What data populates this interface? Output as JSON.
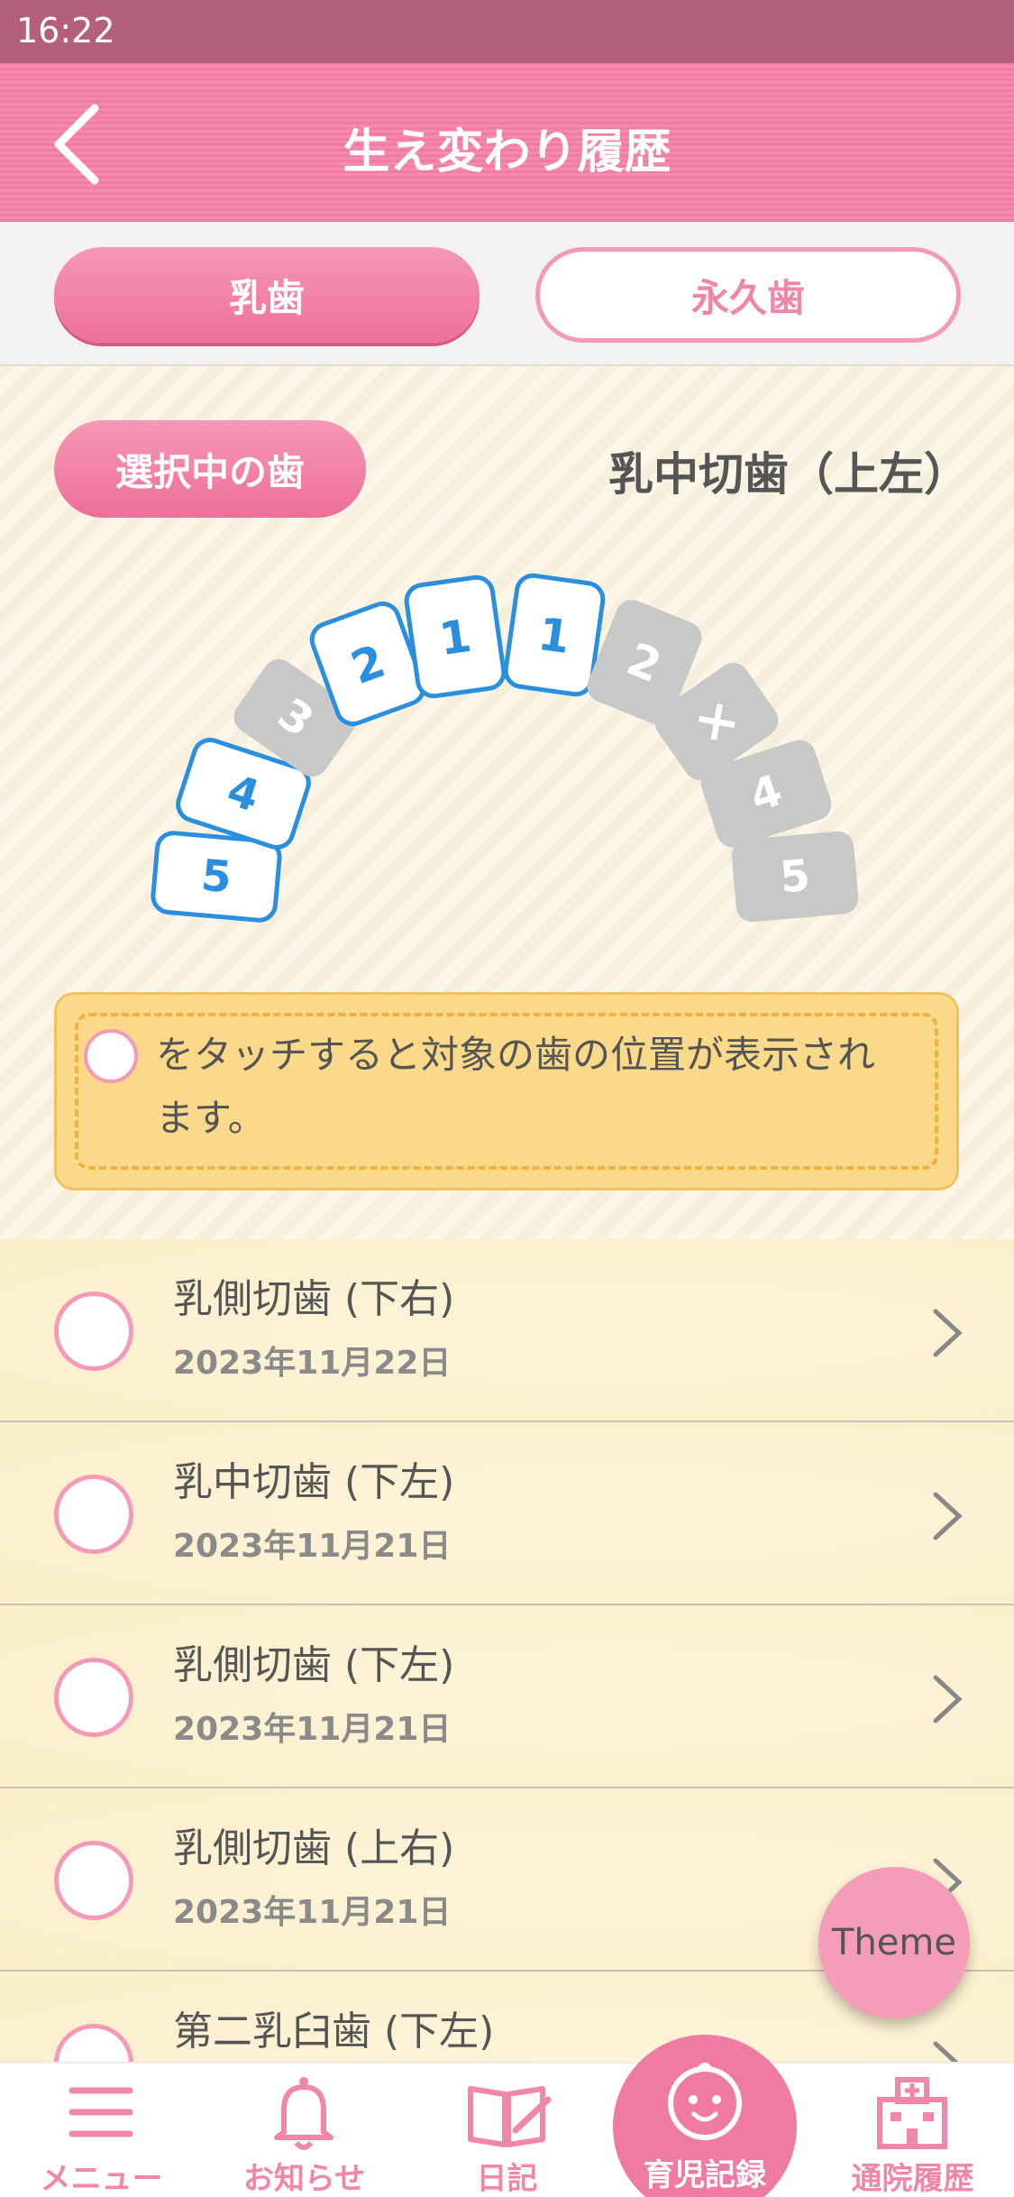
{
  "status": {
    "time": "16:22"
  },
  "header": {
    "title": "生え変わり履歴"
  },
  "tabs": {
    "primary": "乳歯",
    "permanent": "永久歯"
  },
  "selector": {
    "badge": "選択中の歯",
    "selected_tooth": "乳中切歯（上左）",
    "teeth_labels": [
      "5",
      "4",
      "3",
      "2",
      "1",
      "1",
      "2",
      "×",
      "4",
      "5"
    ]
  },
  "hint": {
    "text": "をタッチすると対象の歯の位置が表示されます。"
  },
  "history": [
    {
      "name": "乳側切歯 (下右)",
      "date": "2023年11月22日"
    },
    {
      "name": "乳中切歯 (下左)",
      "date": "2023年11月21日"
    },
    {
      "name": "乳側切歯 (下左)",
      "date": "2023年11月21日"
    },
    {
      "name": "乳側切歯 (上右)",
      "date": "2023年11月21日"
    },
    {
      "name": "第二乳臼歯 (下左)",
      "date": ""
    }
  ],
  "fab": {
    "label": "Theme"
  },
  "nav": {
    "menu": "メニュー",
    "news": "お知らせ",
    "diary": "日記",
    "record": "育児記録",
    "hospital": "通院履歴"
  },
  "colors": {
    "pink": "#f07ba2",
    "blue": "#2b8fe0",
    "gray": "#c8c8c8"
  }
}
